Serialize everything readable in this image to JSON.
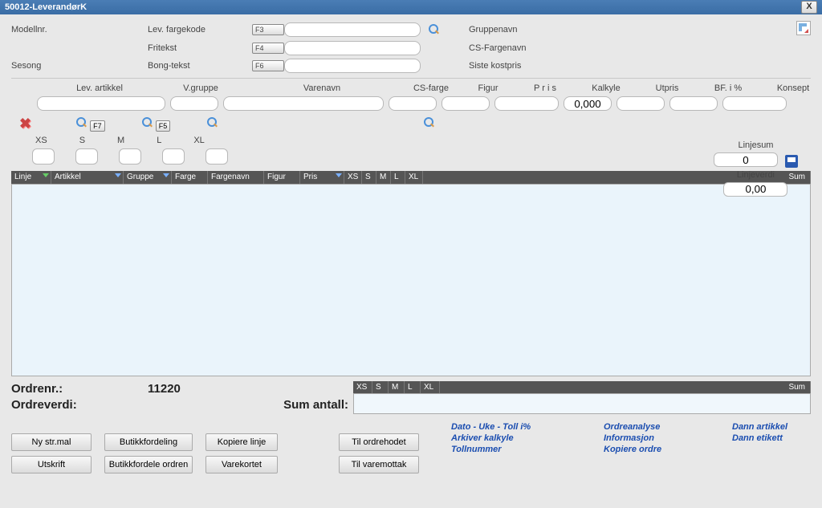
{
  "title": "50012-LeverandørK",
  "topLabels": {
    "modellnr": "Modellnr.",
    "levFargekode": "Lev. fargekode",
    "gruppenavn": "Gruppenavn",
    "fritekst": "Fritekst",
    "csFargenavn": "CS-Fargenavn",
    "sesong": "Sesong",
    "bongTekst": "Bong-tekst",
    "sisteKostpris": "Siste kostpris"
  },
  "fkeys": {
    "f3": "F3",
    "f4": "F4",
    "f6": "F6",
    "f5": "F5",
    "f7": "F7"
  },
  "row2Labels": {
    "levArtikkel": "Lev. artikkel",
    "vGruppe": "V.gruppe",
    "varenavn": "Varenavn",
    "csFarge": "CS-farge",
    "figur": "Figur",
    "pris": "P r i s",
    "kalkyle": "Kalkyle",
    "utpris": "Utpris",
    "bfi": "BF. i %",
    "konsept": "Konsept"
  },
  "row2Values": {
    "kalkyle": "0,000"
  },
  "sizes": {
    "xs": "XS",
    "s": "S",
    "m": "M",
    "l": "L",
    "xl": "XL"
  },
  "rightSum": {
    "linjesumLabel": "Linjesum",
    "linjesumValue": "0",
    "linjeverdiLabel": "Linjeverdi",
    "linjeverdiValue": "0,00"
  },
  "gridHeaders": {
    "linje": "Linje",
    "artikkel": "Artikkel",
    "gruppe": "Gruppe",
    "farge": "Farge",
    "fargenavn": "Fargenavn",
    "figur": "Figur",
    "pris": "Pris",
    "sum": "Sum"
  },
  "summary": {
    "ordrenrLabel": "Ordrenr.:",
    "ordrenrValue": "11220",
    "ordreverdiLabel": "Ordreverdi:",
    "sumAntallLabel": "Sum antall:"
  },
  "buttons": {
    "nyStrmal": "Ny str.mal",
    "butikkfordeling": "Butikkfordeling",
    "kopiereLinje": "Kopiere linje",
    "tilOrdrehodet": "Til ordrehodet",
    "utskrift": "Utskrift",
    "butikkfordeleOrdren": "Butikkfordele ordren",
    "varekortet": "Varekortet",
    "tilVaremottak": "Til varemottak"
  },
  "links": {
    "datoUke": "Dato - Uke - Toll i%",
    "ordreanalyse": "Ordreanalyse",
    "dannArtikkel": "Dann artikkel",
    "arkiverKalkyle": "Arkiver kalkyle",
    "informasjon": "Informasjon",
    "dannEtikett": "Dann etikett",
    "tollnummer": "Tollnummer",
    "kopiereOrdre": "Kopiere ordre"
  }
}
